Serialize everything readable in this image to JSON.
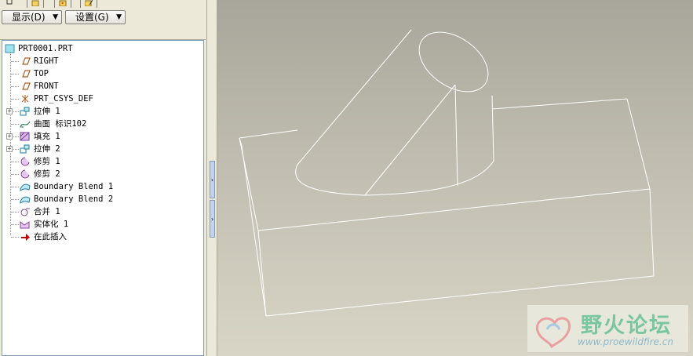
{
  "toolbar": {
    "display_label": "显示(D)",
    "settings_label": "设置(G)"
  },
  "tabs": [
    {
      "icon": "model-tree-icon"
    },
    {
      "icon": "folder-icon"
    },
    {
      "icon": "favorites-icon"
    },
    {
      "icon": "layer-icon"
    }
  ],
  "tree": {
    "root": "PRT0001.PRT",
    "items": [
      {
        "label": "RIGHT",
        "icon": "datum-plane-icon",
        "expandable": false
      },
      {
        "label": "TOP",
        "icon": "datum-plane-icon",
        "expandable": false
      },
      {
        "label": "FRONT",
        "icon": "datum-plane-icon",
        "expandable": false
      },
      {
        "label": "PRT_CSYS_DEF",
        "icon": "csys-icon",
        "expandable": false
      },
      {
        "label": "拉伸 1",
        "icon": "extrude-icon",
        "expandable": true
      },
      {
        "label": "曲面 标识102",
        "icon": "surface-icon",
        "expandable": false
      },
      {
        "label": "填充 1",
        "icon": "fill-icon",
        "expandable": true
      },
      {
        "label": "拉伸 2",
        "icon": "extrude-icon",
        "expandable": true
      },
      {
        "label": "修剪 1",
        "icon": "trim-icon",
        "expandable": false
      },
      {
        "label": "修剪 2",
        "icon": "trim-icon",
        "expandable": false
      },
      {
        "label": "Boundary Blend 1",
        "icon": "boundary-blend-icon",
        "expandable": false
      },
      {
        "label": "Boundary Blend 2",
        "icon": "boundary-blend-icon",
        "expandable": false
      },
      {
        "label": "合并 1",
        "icon": "merge-icon",
        "expandable": false
      },
      {
        "label": "实体化 1",
        "icon": "solidify-icon",
        "expandable": false
      },
      {
        "label": "在此插入",
        "icon": "insert-here-arrow-icon",
        "expandable": false
      }
    ]
  },
  "watermark": {
    "title": "野火论坛",
    "url": "www.proewildfire.cn"
  },
  "colors": {
    "wireframe": "#ffffff",
    "viewport_top": "#a8a59a",
    "viewport_bottom": "#d8d5c6",
    "insert_arrow": "#cc0000",
    "watermark_green": "#79c6a0"
  }
}
